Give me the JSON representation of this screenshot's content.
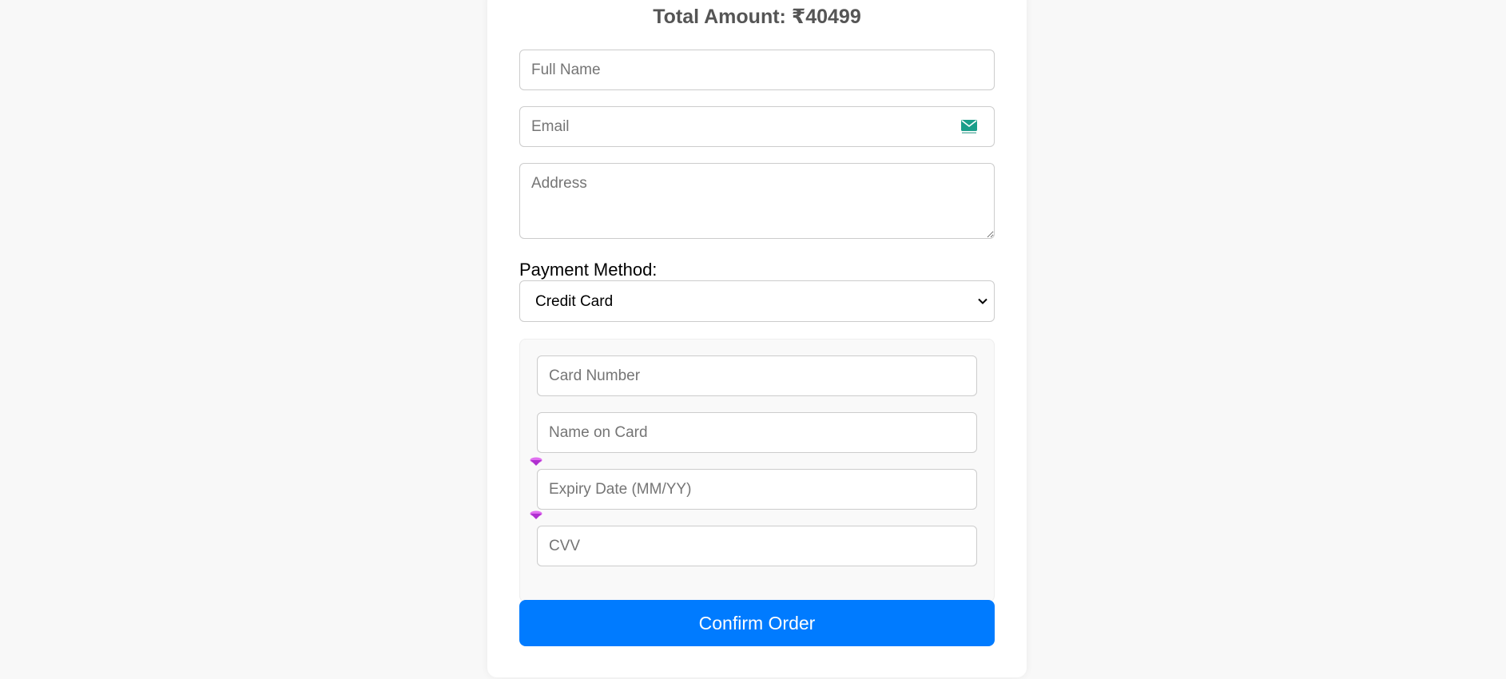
{
  "order": {
    "total_label": "Total Amount: ₹40499"
  },
  "form": {
    "full_name_placeholder": "Full Name",
    "email_placeholder": "Email",
    "address_placeholder": "Address",
    "payment_method_label": "Payment Method:",
    "payment_method_selected": "Credit Card"
  },
  "card_details": {
    "card_number_placeholder": "Card Number",
    "name_on_card_placeholder": "Name on Card",
    "expiry_placeholder": "Expiry Date (MM/YY)",
    "cvv_placeholder": "CVV"
  },
  "actions": {
    "confirm_label": "Confirm Order"
  },
  "icons": {
    "email_field_icon": "envelope-icon",
    "select_chevron": "chevron-down-icon",
    "extension_markers": "gem-icon"
  },
  "colors": {
    "primary_button": "#007bff",
    "heading_text": "#555555",
    "page_background": "#f8f8f8",
    "email_icon": "#1a9e8a",
    "gem_marker": "#c040e0"
  }
}
